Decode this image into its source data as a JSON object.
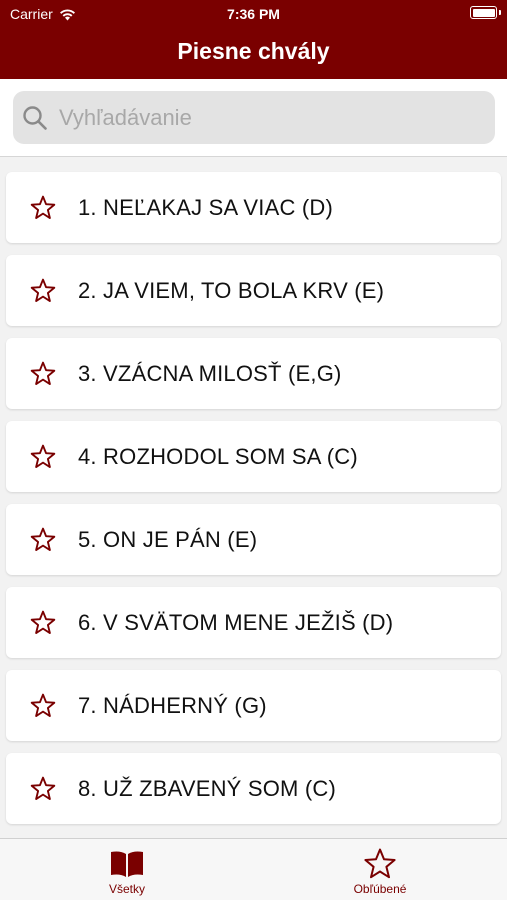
{
  "status_bar": {
    "carrier": "Carrier",
    "time": "7:36 PM"
  },
  "header": {
    "title": "Piesne chvály"
  },
  "search": {
    "placeholder": "Vyhľadávanie",
    "value": ""
  },
  "songs": [
    {
      "label": "1. NEĽAKAJ SA VIAC (D)"
    },
    {
      "label": "2. JA VIEM, TO BOLA KRV (E)"
    },
    {
      "label": "3. VZÁCNA MILOSŤ (E,G)"
    },
    {
      "label": "4. ROZHODOL SOM SA (C)"
    },
    {
      "label": "5. ON JE PÁN (E)"
    },
    {
      "label": "6. V SVÄTOM MENE JEŽIŠ (D)"
    },
    {
      "label": "7. NÁDHERNÝ (G)"
    },
    {
      "label": "8. UŽ ZBAVENÝ SOM (C)"
    }
  ],
  "tabs": [
    {
      "label": "Všetky",
      "icon": "book-icon"
    },
    {
      "label": "Obľúbené",
      "icon": "star-icon"
    }
  ],
  "colors": {
    "accent": "#7a0000",
    "background": "#f2f2f2",
    "search_bg": "#e3e3e3"
  }
}
